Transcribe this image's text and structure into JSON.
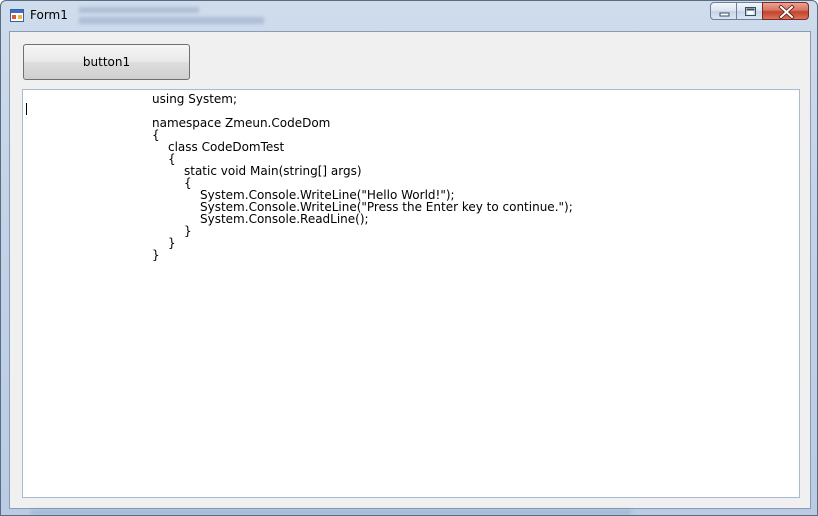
{
  "window": {
    "title": "Form1",
    "controls": {
      "minimize_icon": "minimize-icon",
      "maximize_icon": "maximize-icon",
      "close_icon": "close-icon"
    }
  },
  "button": {
    "label": "button1"
  },
  "textbox": {
    "lines": [
      "using System;",
      "namespace Zmeun.CodeDom",
      "{",
      "class CodeDomTest",
      "{",
      "static void Main(string[] args)",
      "{",
      "System.Console.WriteLine(\"Hello World!\");",
      "System.Console.WriteLine(\"Press the Enter key to continue.\");",
      "System.Console.ReadLine();",
      "}",
      "}",
      "}"
    ]
  },
  "colors": {
    "close_button": "#c9452f",
    "frame": "#c3d3e8",
    "client_background": "#f0f0f0"
  }
}
